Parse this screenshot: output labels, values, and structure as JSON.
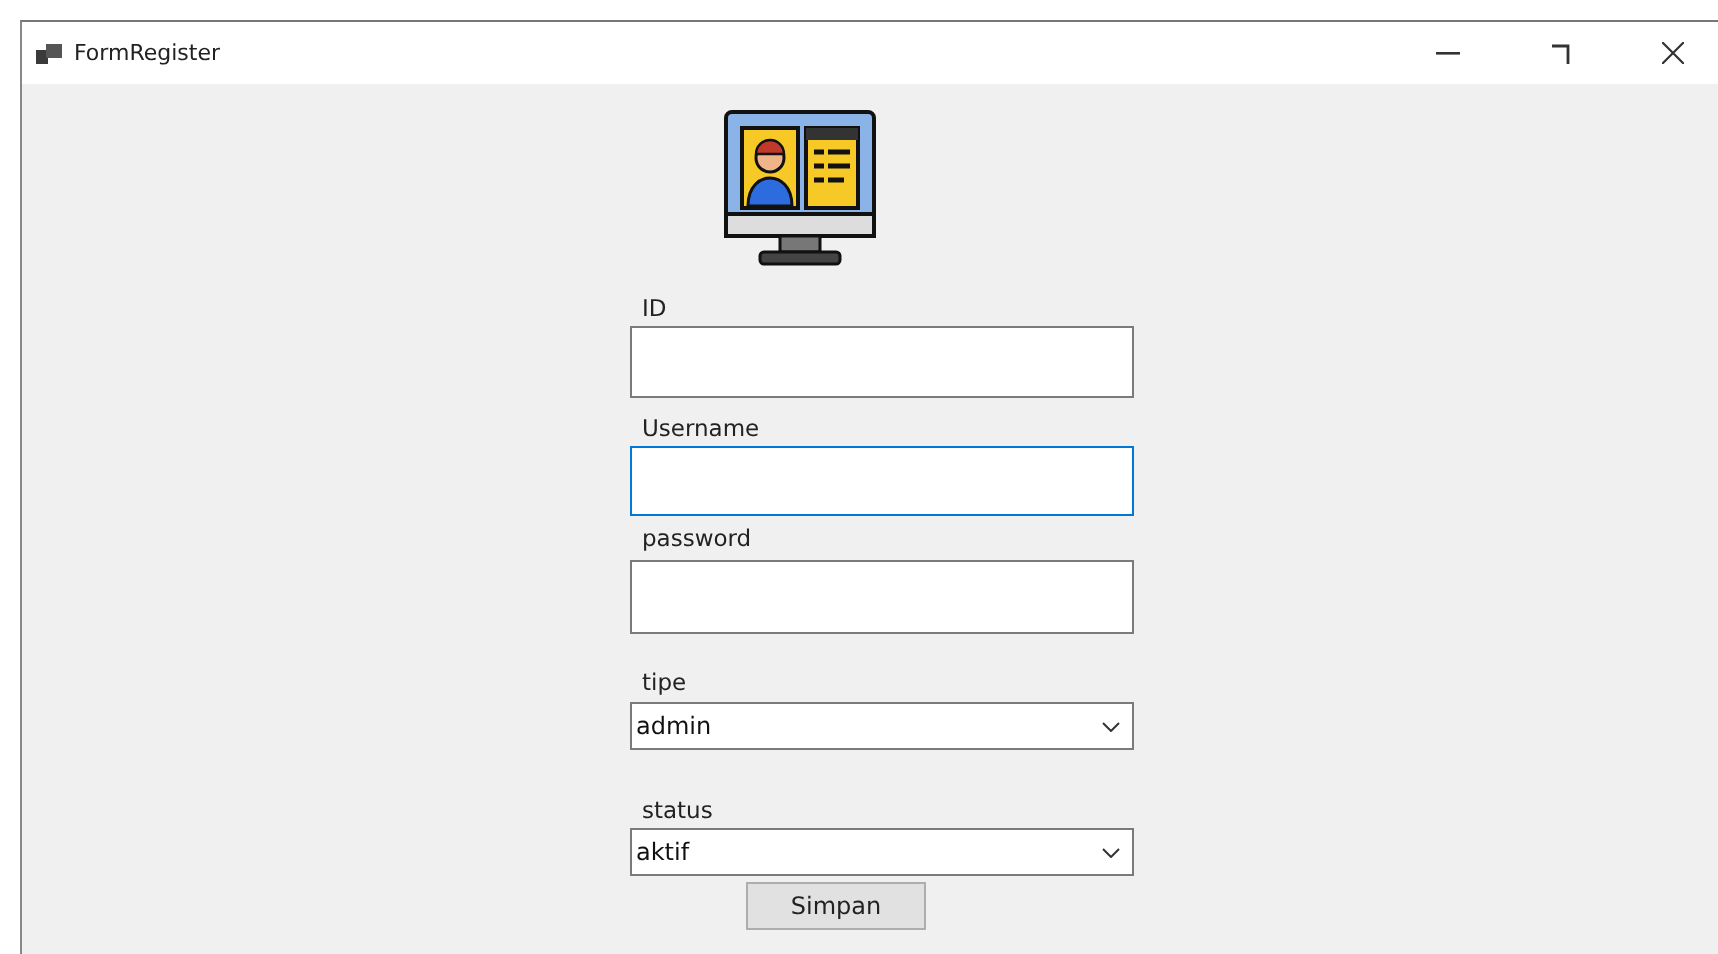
{
  "window": {
    "title": "FormRegister"
  },
  "fields": [
    {
      "kind": "text",
      "label": "ID",
      "focused": false
    },
    {
      "kind": "text",
      "label": "Username",
      "focused": true
    },
    {
      "kind": "text",
      "label": "password",
      "focused": false
    },
    {
      "kind": "combo",
      "label": "tipe",
      "value": "admin",
      "focused": false
    },
    {
      "kind": "combo",
      "label": "status",
      "value": "aktif",
      "focused": false
    }
  ],
  "buttons": [
    "Simpan"
  ]
}
